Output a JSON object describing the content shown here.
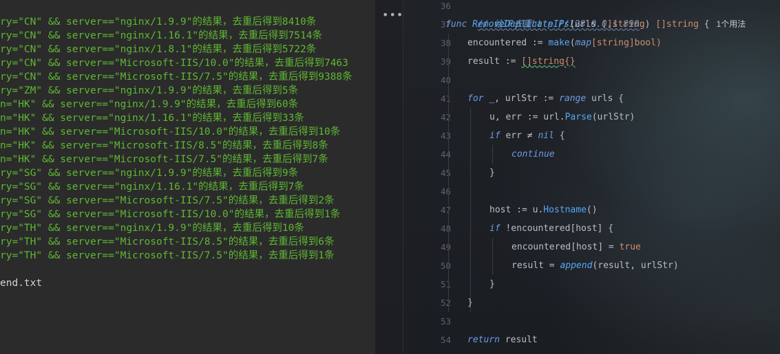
{
  "terminal": {
    "lines": [
      "ry=\"CN\" && server==\"nginx/1.9.9\"的结果，去重后得到8410条",
      "ry=\"CN\" && server==\"nginx/1.16.1\"的结果，去重后得到7514条",
      "ry=\"CN\" && server==\"nginx/1.8.1\"的结果，去重后得到5722条",
      "ry=\"CN\" && server==\"Microsoft-IIS/10.0\"的结果，去重后得到7463",
      "ry=\"CN\" && server==\"Microsoft-IIS/7.5\"的结果，去重后得到9388条",
      "ry=\"ZM\" && server==\"nginx/1.9.9\"的结果，去重后得到5条",
      "n=\"HK\" && server==\"nginx/1.9.9\"的结果，去重后得到60条",
      "n=\"HK\" && server==\"nginx/1.16.1\"的结果，去重后得到33条",
      "n=\"HK\" && server==\"Microsoft-IIS/10.0\"的结果，去重后得到10条",
      "n=\"HK\" && server==\"Microsoft-IIS/8.5\"的结果，去重后得到8条",
      "n=\"HK\" && server==\"Microsoft-IIS/7.5\"的结果，去重后得到7条",
      "ry=\"SG\" && server==\"nginx/1.9.9\"的结果，去重后得到9条",
      "ry=\"SG\" && server==\"nginx/1.16.1\"的结果，去重后得到7条",
      "ry=\"SG\" && server==\"Microsoft-IIS/7.5\"的结果，去重后得到2条",
      "ry=\"SG\" && server==\"Microsoft-IIS/10.0\"的结果，去重后得到1条",
      "ry=\"TH\" && server==\"nginx/1.9.9\"的结果，去重后得到10条",
      "ry=\"TH\" && server==\"Microsoft-IIS/8.5\"的结果，去重后得到6条",
      "ry=\"TH\" && server==\"Microsoft-IIS/7.5\"的结果，去重后得到1条"
    ],
    "footer": "end.txt"
  },
  "editor": {
    "more_icon": "more-horizontal-icon",
    "line_numbers": [
      "36",
      "37",
      "38",
      "39",
      "40",
      "41",
      "42",
      "43",
      "44",
      "45",
      "46",
      "47",
      "48",
      "49",
      "50",
      "51",
      "52",
      "53",
      "54"
    ],
    "code": {
      "l36": "// 给IP去重http //128.0.0.1 890",
      "l37_func": "func",
      "l37_name": "RemoveDuplicateIPs",
      "l37_params": "(urls ",
      "l37_ptype": "[]string",
      "l37_close": ") ",
      "l37_rtype": "[]string",
      "l37_brace": " {",
      "l37_hint": "1个用法",
      "l38_a": "encountered := ",
      "l38_make": "make",
      "l38_b": "(",
      "l38_map": "map",
      "l38_c": "[string]bool)",
      "l39_a": "result := ",
      "l39_b": "[]string{}",
      "l41_for": "for",
      "l41_a": " _, urlStr := ",
      "l41_range": "range",
      "l41_b": " urls {",
      "l42_a": "u, err := ",
      "l42_pkg": "url",
      "l42_dot": ".",
      "l42_fn": "Parse",
      "l42_b": "(urlStr)",
      "l43_if": "if",
      "l43_a": " err ≠ ",
      "l43_nil": "nil",
      "l43_b": " {",
      "l44_continue": "continue",
      "l45_close": "}",
      "l47_a": "host := u.",
      "l47_fn": "Hostname",
      "l47_b": "()",
      "l48_if": "if",
      "l48_a": " !encountered[host] {",
      "l49_a": "encountered[host] = ",
      "l49_true": "true",
      "l50_a": "result = ",
      "l50_fn": "append",
      "l50_b": "(result, urlStr)",
      "l51_close": "}",
      "l52_close": "}",
      "l54_return": "return",
      "l54_a": " result"
    }
  },
  "colors": {
    "terminal_bg": "#2b2b2b",
    "terminal_text": "#5fb832",
    "editor_keyword": "#6d9be5",
    "editor_function": "#56a8f5",
    "editor_literal": "#cf8e6d"
  }
}
